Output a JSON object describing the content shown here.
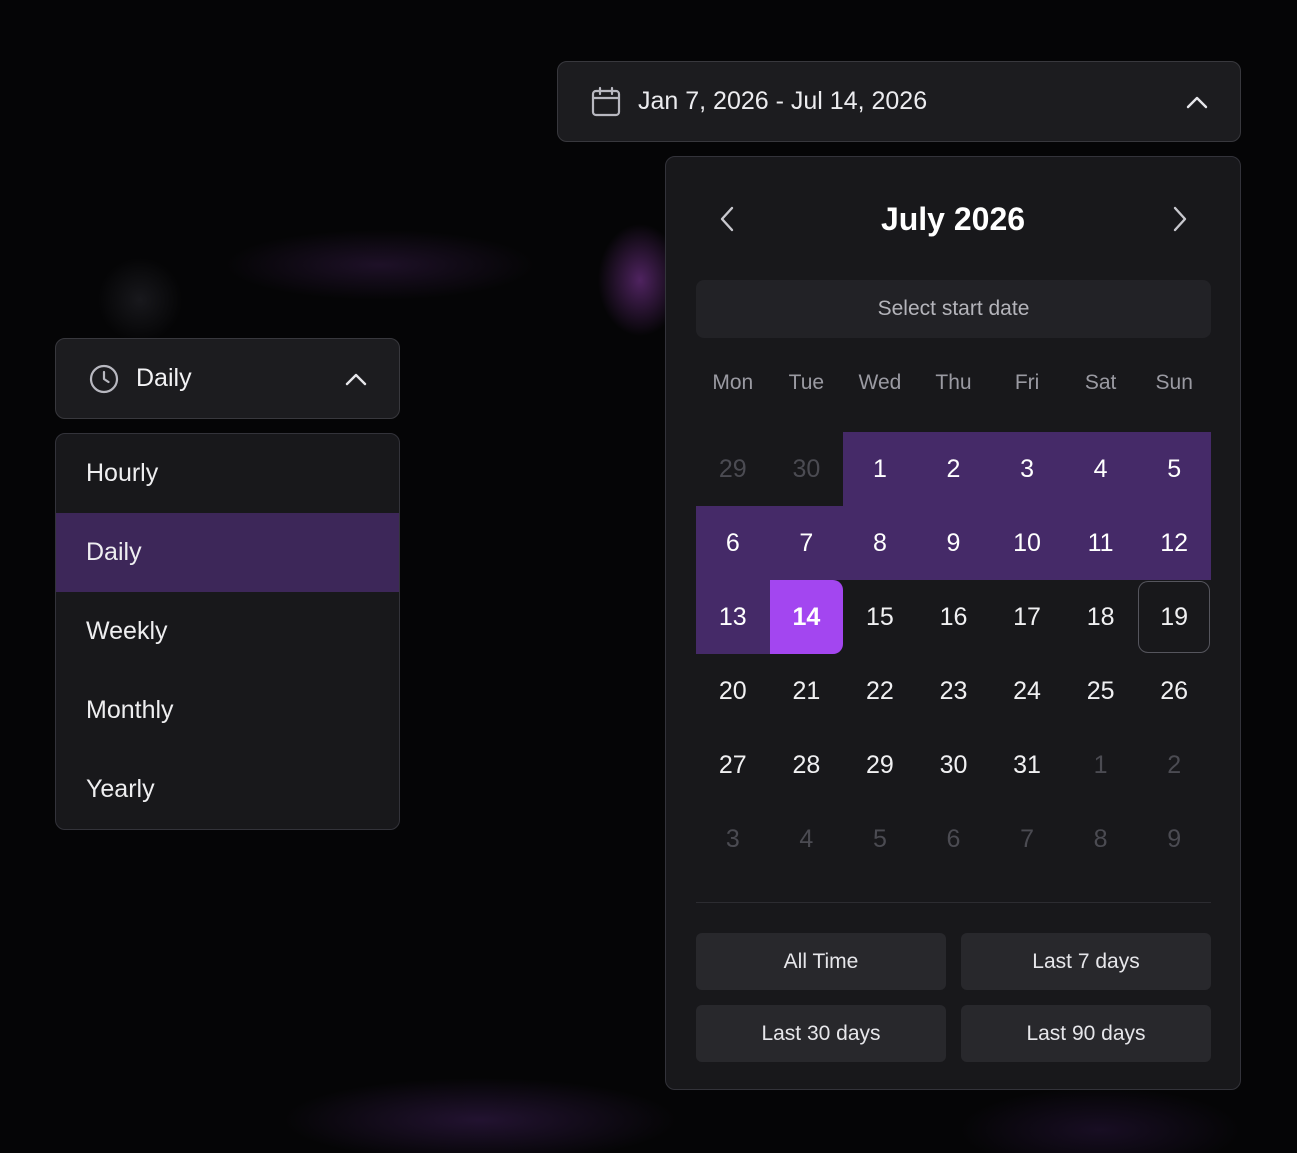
{
  "interval": {
    "selected_label": "Daily",
    "options": [
      {
        "label": "Hourly",
        "selected": false
      },
      {
        "label": "Daily",
        "selected": true
      },
      {
        "label": "Weekly",
        "selected": false
      },
      {
        "label": "Monthly",
        "selected": false
      },
      {
        "label": "Yearly",
        "selected": false
      }
    ]
  },
  "date_range": {
    "trigger_label": "Jan 7, 2026 - Jul 14, 2026",
    "calendar": {
      "month_title": "July 2026",
      "hint": "Select start date",
      "weekdays": [
        "Mon",
        "Tue",
        "Wed",
        "Thu",
        "Fri",
        "Sat",
        "Sun"
      ],
      "days": [
        {
          "d": "29",
          "state": "outside"
        },
        {
          "d": "30",
          "state": "outside"
        },
        {
          "d": "1",
          "state": "in-range"
        },
        {
          "d": "2",
          "state": "in-range"
        },
        {
          "d": "3",
          "state": "in-range"
        },
        {
          "d": "4",
          "state": "in-range"
        },
        {
          "d": "5",
          "state": "in-range"
        },
        {
          "d": "6",
          "state": "in-range"
        },
        {
          "d": "7",
          "state": "in-range"
        },
        {
          "d": "8",
          "state": "in-range"
        },
        {
          "d": "9",
          "state": "in-range"
        },
        {
          "d": "10",
          "state": "in-range"
        },
        {
          "d": "11",
          "state": "in-range"
        },
        {
          "d": "12",
          "state": "in-range"
        },
        {
          "d": "13",
          "state": "in-range"
        },
        {
          "d": "14",
          "state": "range-end"
        },
        {
          "d": "15",
          "state": "normal"
        },
        {
          "d": "16",
          "state": "normal"
        },
        {
          "d": "17",
          "state": "normal"
        },
        {
          "d": "18",
          "state": "normal"
        },
        {
          "d": "19",
          "state": "today"
        },
        {
          "d": "20",
          "state": "normal"
        },
        {
          "d": "21",
          "state": "normal"
        },
        {
          "d": "22",
          "state": "normal"
        },
        {
          "d": "23",
          "state": "normal"
        },
        {
          "d": "24",
          "state": "normal"
        },
        {
          "d": "25",
          "state": "normal"
        },
        {
          "d": "26",
          "state": "normal"
        },
        {
          "d": "27",
          "state": "normal"
        },
        {
          "d": "28",
          "state": "normal"
        },
        {
          "d": "29",
          "state": "normal"
        },
        {
          "d": "30",
          "state": "normal"
        },
        {
          "d": "31",
          "state": "normal"
        },
        {
          "d": "1",
          "state": "outside"
        },
        {
          "d": "2",
          "state": "outside"
        },
        {
          "d": "3",
          "state": "outside"
        },
        {
          "d": "4",
          "state": "outside"
        },
        {
          "d": "5",
          "state": "outside"
        },
        {
          "d": "6",
          "state": "outside"
        },
        {
          "d": "7",
          "state": "outside"
        },
        {
          "d": "8",
          "state": "outside"
        },
        {
          "d": "9",
          "state": "outside"
        }
      ],
      "presets": [
        "All Time",
        "Last 7 days",
        "Last 30 days",
        "Last 90 days"
      ]
    }
  },
  "icons": {
    "interval_icon": "clock-icon",
    "range_icon": "calendar-icon",
    "trigger_chevron": "chevron-up-icon",
    "prev": "chevron-left-icon",
    "next": "chevron-right-icon"
  },
  "colors": {
    "range_fill": "#452a68",
    "range_end": "#a346f0",
    "selected_option": "#3d2759"
  }
}
